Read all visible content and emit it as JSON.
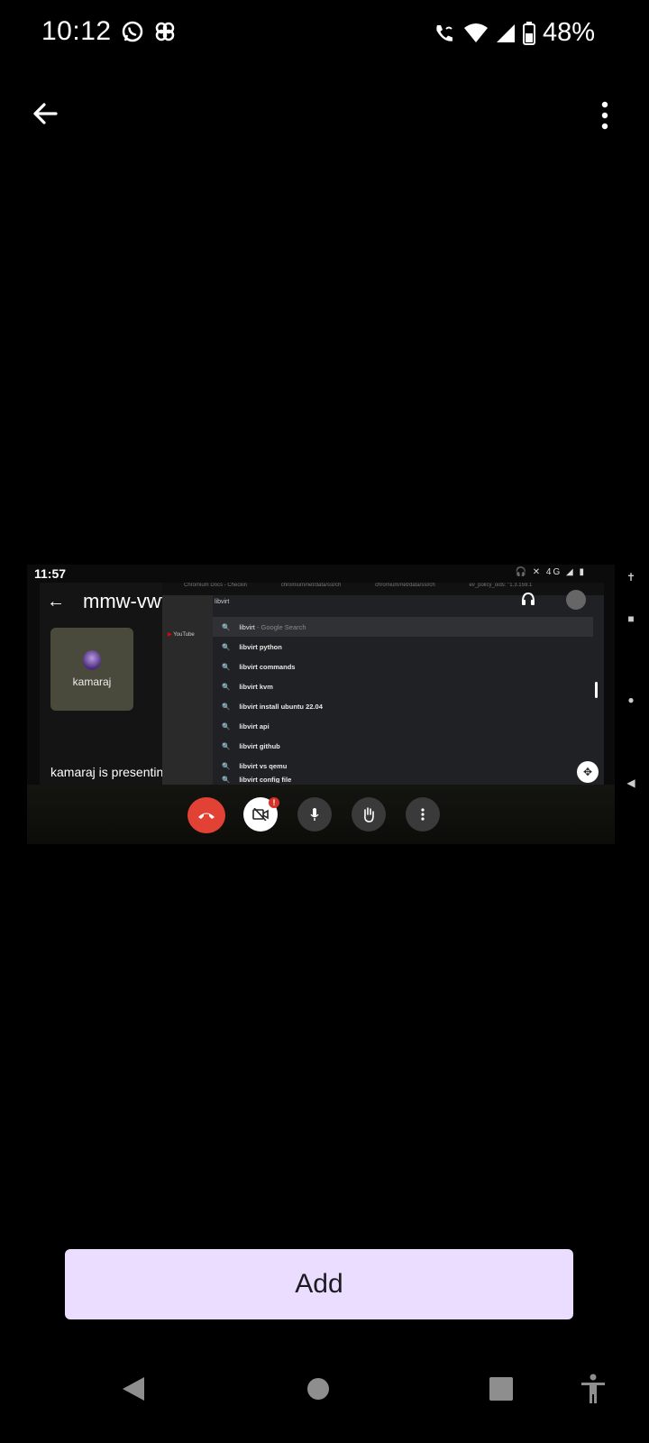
{
  "status_bar": {
    "time": "10:12",
    "battery": "48%",
    "icons": [
      "whatsapp-icon",
      "pinwheel-icon",
      "wifi-calling-icon",
      "wifi-icon",
      "signal-icon",
      "battery-icon"
    ]
  },
  "app_bar": {
    "back_icon": "arrow-left-icon",
    "more_icon": "more-vert-icon"
  },
  "preview": {
    "status_time": "11:57",
    "meeting_title": "mmw-vwto-tkg",
    "participant_name": "kamaraj",
    "presenting_text": "kamaraj is presenting",
    "browser": {
      "tabs": [
        "Chromium Docs - Checkin",
        "chromium/net/data/ssl/ch",
        "chromium/net/data/ssl/ch",
        "ev_policy_oids: \"1.3.159.1"
      ],
      "sidebar_item": "YouTube",
      "omnibox": "libvirt",
      "suggestions": [
        {
          "text": "libvirt",
          "suffix": "- Google Search"
        },
        {
          "text": "libvirt python"
        },
        {
          "text": "libvirt commands"
        },
        {
          "text": "libvirt kvm"
        },
        {
          "text": "libvirt install ubuntu 22.04"
        },
        {
          "text": "libvirt api"
        },
        {
          "text": "libvirt github"
        },
        {
          "text": "libvirt vs qemu"
        },
        {
          "text": "libvirt config file"
        }
      ]
    },
    "controls": [
      "end-call-icon",
      "camera-off-icon",
      "mic-icon",
      "raise-hand-icon",
      "more-vert-icon"
    ],
    "camera_badge": "!"
  },
  "add_button": {
    "label": "Add"
  },
  "nav_bar": {
    "items": [
      "back-icon",
      "home-icon",
      "recents-icon",
      "accessibility-icon"
    ]
  },
  "colors": {
    "background": "#000000",
    "add_button_bg": "#eaddff",
    "end_call": "#e24235"
  }
}
